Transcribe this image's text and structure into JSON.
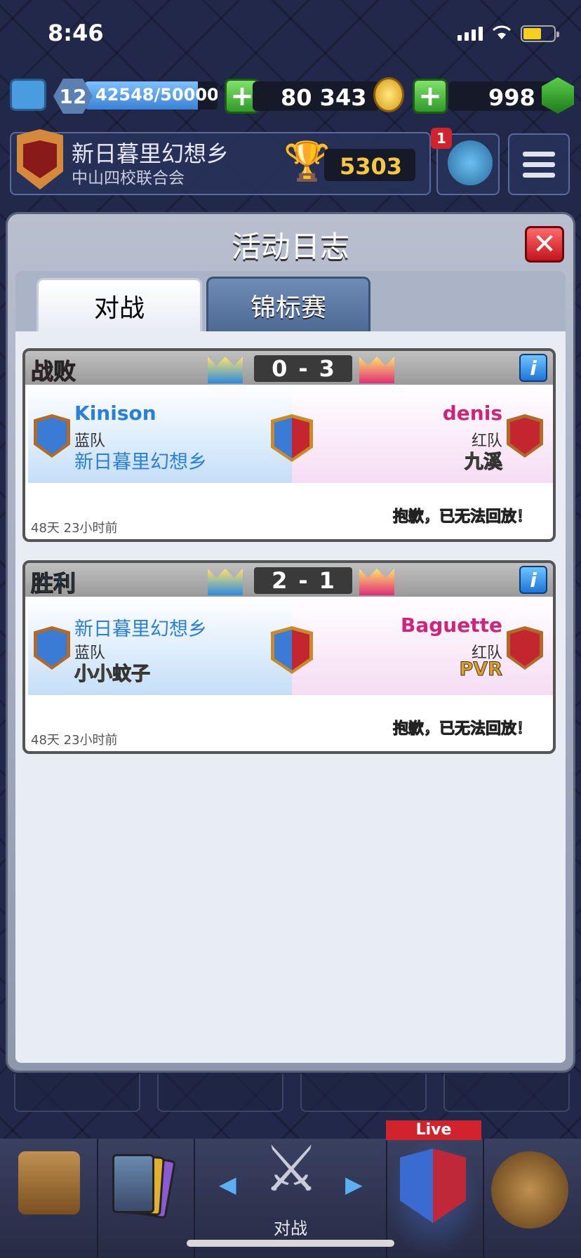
{
  "status_bar": {
    "time": "8:46"
  },
  "resources": {
    "level": "12",
    "xp": "42548/50000",
    "xp_progress": 0.851,
    "gold": "80 343",
    "gems": "998",
    "plus_label": "+"
  },
  "clan": {
    "name": "新日暮里幻想乡",
    "subtitle": "中山四校联合会",
    "trophies": "5303"
  },
  "notification_count": "1",
  "modal": {
    "title": "活动日志",
    "close_label": "✕",
    "tabs": [
      {
        "label": "对战",
        "active": true
      },
      {
        "label": "锦标赛",
        "active": false
      }
    ]
  },
  "battles": [
    {
      "result": "战败",
      "result_color": "#e0305a",
      "blue_crowns": "0",
      "separator": "-",
      "red_crowns": "3",
      "info_label": "i",
      "left": {
        "name": "Kinison",
        "team": "蓝队",
        "clan": "新日暮里幻想乡"
      },
      "right": {
        "name": "denis",
        "team": "红队",
        "clan": "九溪"
      },
      "replay_status": "抱歉，已无法回放！",
      "time": "48天 23小时前"
    },
    {
      "result": "胜利",
      "result_color": "#3a8be0",
      "blue_crowns": "2",
      "separator": "-",
      "red_crowns": "1",
      "info_label": "i",
      "left": {
        "name": "新日暮里幻想乡",
        "team": "蓝队",
        "clan": "小小蚊子"
      },
      "right": {
        "name": "Baguette",
        "team": "红队",
        "clan": "PVR"
      },
      "replay_status": "抱歉，已无法回放！",
      "time": "48天 23小时前"
    }
  ],
  "nav": {
    "battle_label": "对战",
    "live_label": "Live",
    "arrow_left": "◀",
    "arrow_right": "▶"
  }
}
